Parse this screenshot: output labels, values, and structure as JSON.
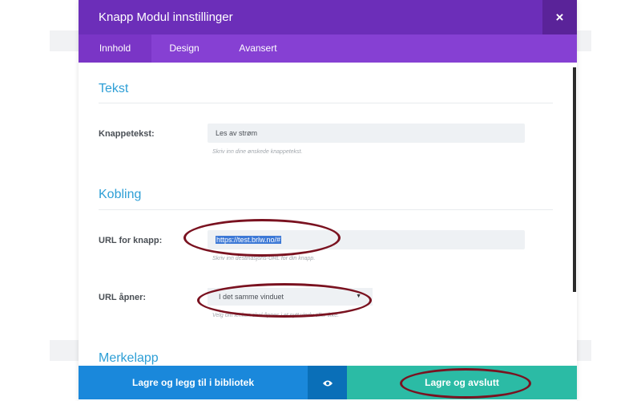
{
  "modal": {
    "title": "Knapp Modul innstillinger",
    "close_label": "×",
    "tabs": [
      {
        "label": "Innhold",
        "active": true
      },
      {
        "label": "Design",
        "active": false
      },
      {
        "label": "Avansert",
        "active": false
      }
    ]
  },
  "sections": {
    "tekst": {
      "title": "Tekst",
      "button_text_label": "Knappetekst:",
      "button_text_value": "Les av strøm",
      "button_text_hint": "Skriv inn dine ønskede knappetekst."
    },
    "kobling": {
      "title": "Kobling",
      "url_label": "URL for knapp:",
      "url_value": "https://test.brlw.no/#",
      "url_hint": "Skriv inn destinasjons-URL for din knapp.",
      "opens_label": "URL åpner:",
      "opens_value": "I det samme vinduet",
      "opens_hint": "Velg om lenken skal åpnes i et nytt vindu eller ikke."
    },
    "merkelapp": {
      "title": "Merkelapp"
    }
  },
  "footer": {
    "save_library_label": "Lagre og legg til i bibliotek",
    "preview_icon": "eye-icon",
    "save_exit_label": "Lagre og avslutt"
  },
  "colors": {
    "title_bar": "#6c2eb9",
    "tab_bar": "#8640d3",
    "section_title": "#2e9fd6",
    "save_library_button": "#1a88db",
    "preview_button": "#0a6fb8",
    "save_exit_button": "#2bbba5",
    "annotation_oval": "#7a1220"
  }
}
